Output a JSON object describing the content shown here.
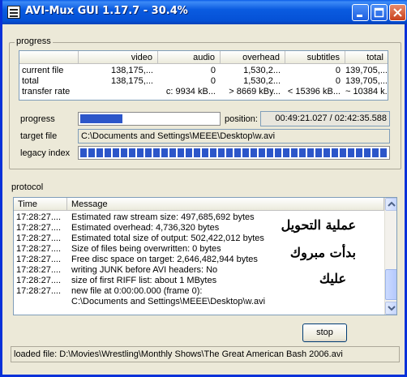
{
  "window": {
    "title": "AVI-Mux GUI 1.17.7 - 30.4%"
  },
  "progress_group": {
    "label": "progress",
    "columns": [
      "",
      "video",
      "audio",
      "overhead",
      "subtitles",
      "total"
    ],
    "rows": [
      {
        "label": "current file",
        "video": "138,175,...",
        "audio": "0",
        "overhead": "1,530,2...",
        "subtitles": "0",
        "total": "139,705,..."
      },
      {
        "label": "total",
        "video": "138,175,...",
        "audio": "0",
        "overhead": "1,530,2...",
        "subtitles": "0",
        "total": "139,705,..."
      },
      {
        "label": "transfer rate",
        "video": "",
        "audio": "c: 9934 kB...",
        "overhead": "> 8669 kBy...",
        "subtitles": "< 15396 kB...",
        "total": "~ 10384 k..."
      }
    ],
    "progress_label": "progress",
    "progress_value": 0.304,
    "position_label": "position:",
    "position_value": "00:49:21.027 / 02:42:35.588",
    "target_label": "target file",
    "target_value": "C:\\Documents and Settings\\MEEE\\Desktop\\w.avi",
    "legacy_label": "legacy index"
  },
  "protocol": {
    "label": "protocol",
    "columns": [
      "Time",
      "Message"
    ],
    "rows": [
      {
        "time": "17:28:27....",
        "message": "Estimated raw stream size: 497,685,692 bytes"
      },
      {
        "time": "17:28:27....",
        "message": "Estimated overhead: 4,736,320 bytes"
      },
      {
        "time": "17:28:27....",
        "message": "Estimated total size of output: 502,422,012 bytes"
      },
      {
        "time": "17:28:27....",
        "message": "Size of files being overwritten: 0 bytes"
      },
      {
        "time": "17:28:27....",
        "message": "Free disc space on target: 2,646,482,944 bytes"
      },
      {
        "time": "17:28:27....",
        "message": "writing JUNK before AVI headers: No"
      },
      {
        "time": "17:28:27....",
        "message": "size of first RIFF list: about 1 MBytes"
      },
      {
        "time": "17:28:27....",
        "message": "new file at 0:00:00.000 (frame 0):"
      },
      {
        "time": "",
        "message": "C:\\Documents and Settings\\MEEE\\Desktop\\w.avi"
      }
    ],
    "overlay_lines": [
      "عملية التحويل",
      "بدأت مبروك",
      "عليك"
    ]
  },
  "stop_button": "stop",
  "status_bar": "loaded file: D:\\Movies\\Wrestling\\Monthly Shows\\The Great American Bash 2006.avi",
  "colors": {
    "titlebar": "#0a5be0",
    "progress_fill": "#2c56c9",
    "window_bg": "#ece9d8"
  },
  "icons": [
    "app-icon",
    "minimize-icon",
    "maximize-icon",
    "close-icon",
    "scroll-up-icon",
    "scroll-down-icon"
  ]
}
